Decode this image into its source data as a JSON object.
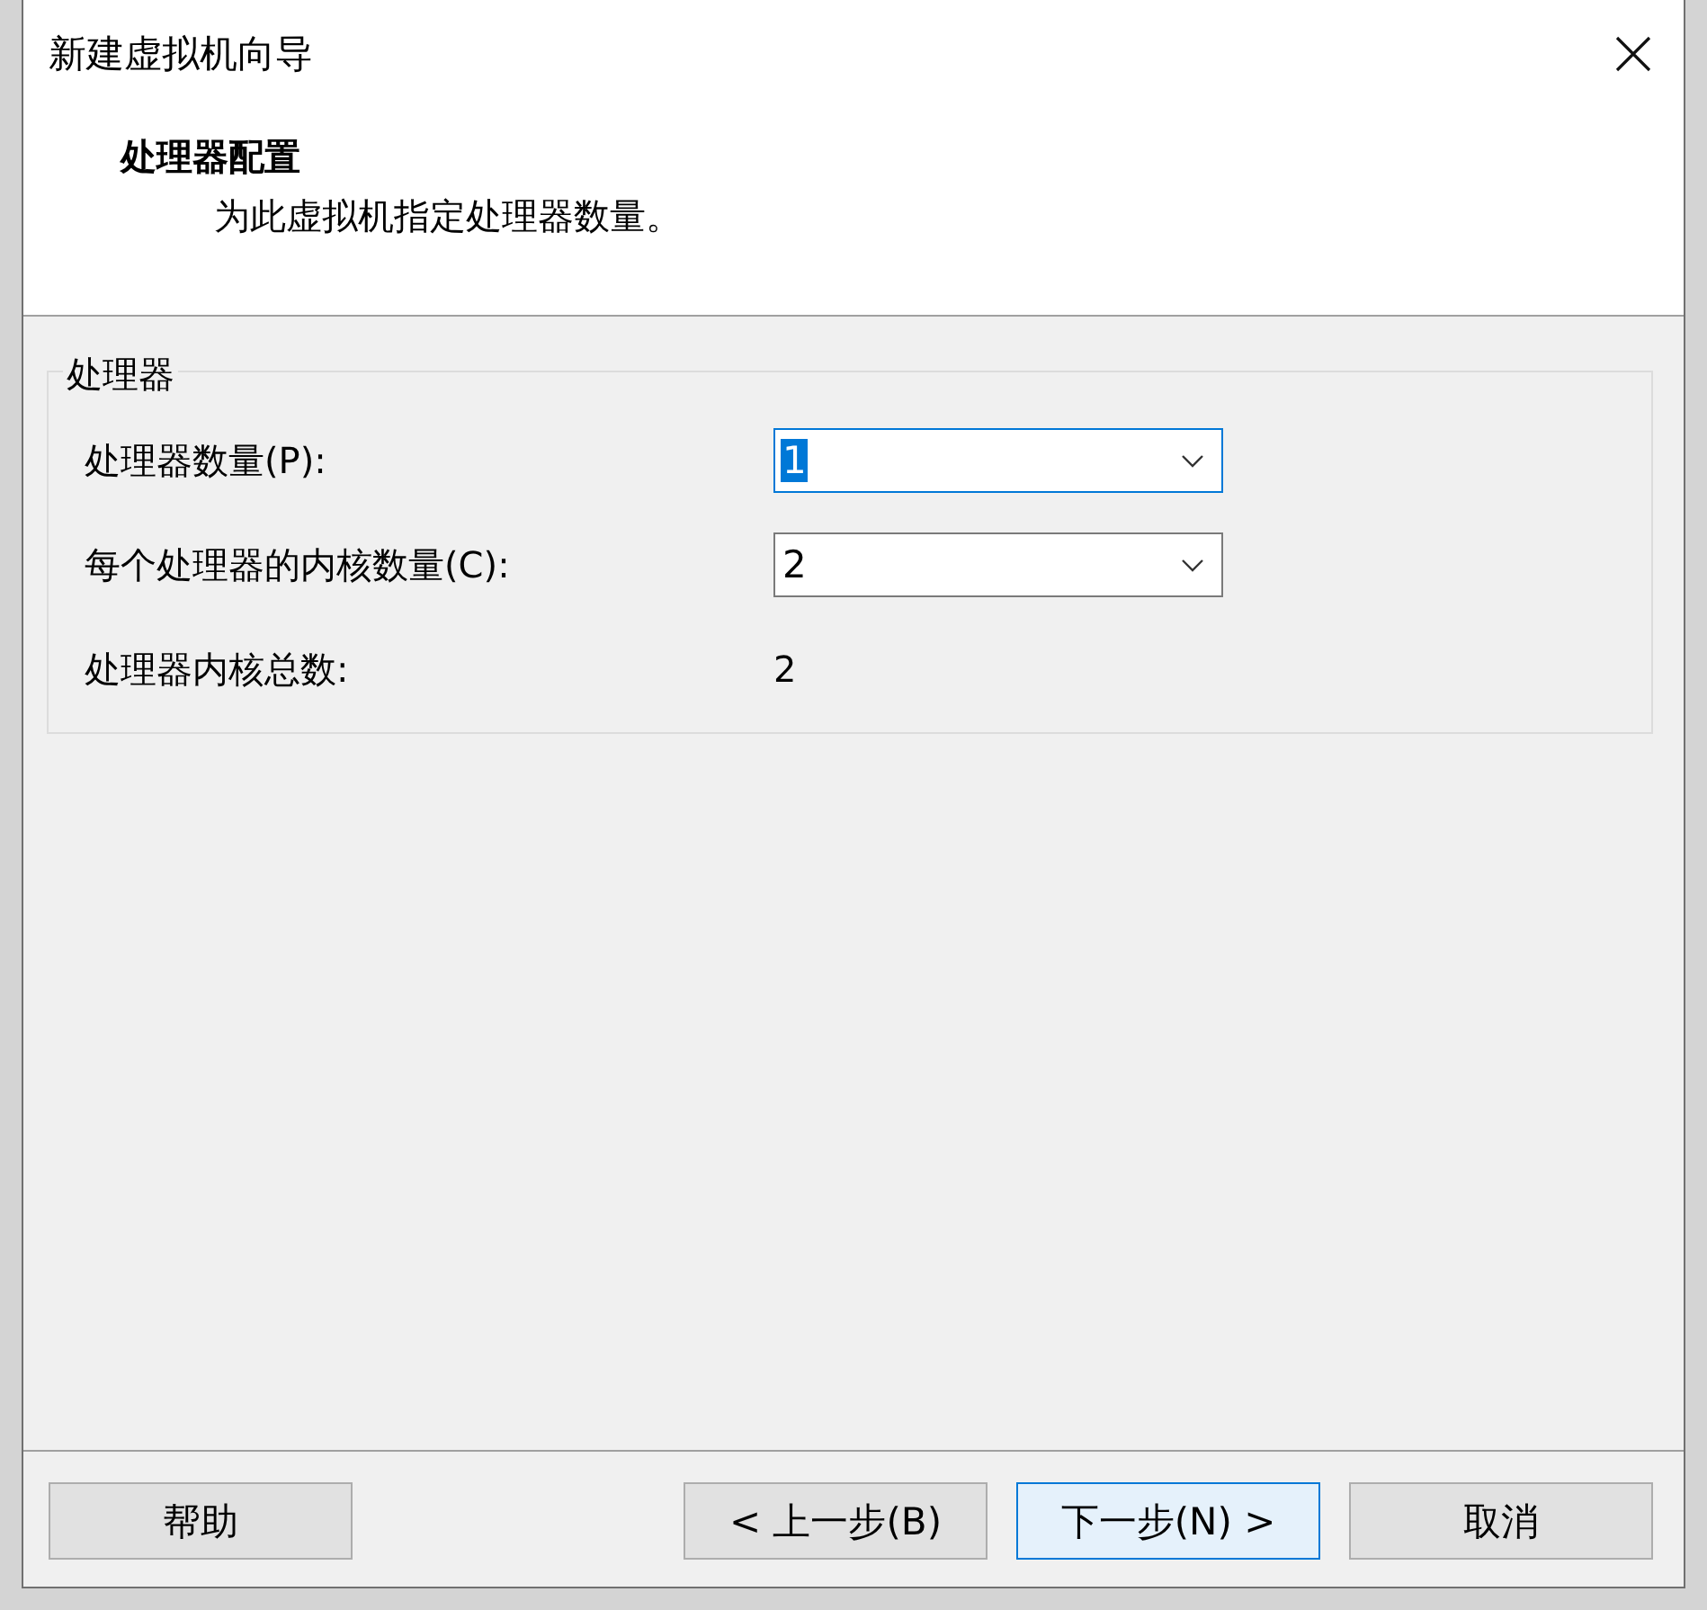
{
  "window": {
    "title": "新建虚拟机向导"
  },
  "header": {
    "title": "处理器配置",
    "subtitle": "为此虚拟机指定处理器数量。"
  },
  "group": {
    "title": "处理器",
    "fields": [
      {
        "kind": "dropdown",
        "label": "处理器数量(P):",
        "value": "1",
        "focused": true
      },
      {
        "kind": "dropdown",
        "label": "每个处理器的内核数量(C):",
        "value": "2",
        "focused": false
      },
      {
        "kind": "readout",
        "label": "处理器内核总数:",
        "value": "2"
      }
    ]
  },
  "footer": {
    "left_buttons": [
      {
        "label": "帮助",
        "default": false
      }
    ],
    "right_buttons": [
      {
        "label": "< 上一步(B)",
        "default": false
      },
      {
        "label": "下一步(N) >",
        "default": true
      },
      {
        "label": "取消",
        "default": false
      }
    ]
  }
}
